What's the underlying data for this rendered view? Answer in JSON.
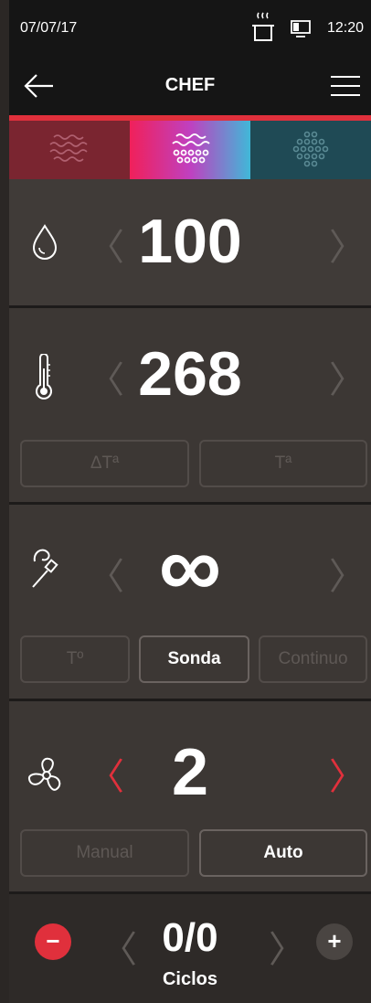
{
  "status_bar": {
    "date": "07/07/17",
    "time": "12:20",
    "icons": [
      "cooking-pot-icon",
      "monitor-icon"
    ]
  },
  "header": {
    "title": "CHEF",
    "back_icon": "arrow-left-icon",
    "menu_icon": "hamburger-menu-icon"
  },
  "mode_tabs": [
    {
      "icon": "waves-icon",
      "color": "#7a2530",
      "selected": false
    },
    {
      "icon": "waves-dotted-icon",
      "color": "#f0205a",
      "selected": true
    },
    {
      "icon": "dots-icon",
      "color": "#1f4a55",
      "selected": false
    }
  ],
  "humidity": {
    "icon": "droplet-icon",
    "value": "100",
    "prev": "〈",
    "next": "〉"
  },
  "temperature": {
    "icon": "thermometer-icon",
    "value": "268",
    "prev": "〈",
    "next": "〉",
    "buttons": [
      {
        "label": "ΔTª",
        "active": false
      },
      {
        "label": "Tª",
        "active": false
      }
    ]
  },
  "probe": {
    "icon": "probe-icon",
    "value": "∞",
    "prev": "〈",
    "next": "〉",
    "buttons": [
      {
        "label": "Tº",
        "active": false
      },
      {
        "label": "Sonda",
        "active": true
      },
      {
        "label": "Continuo",
        "active": false
      }
    ]
  },
  "fan": {
    "icon": "fan-icon",
    "value": "2",
    "prev": "〈",
    "next": "〉",
    "arrow_color": "#e0303c",
    "buttons": [
      {
        "label": "Manual",
        "active": false
      },
      {
        "label": "Auto",
        "active": true
      }
    ]
  },
  "cycles": {
    "value": "0/0",
    "label": "Ciclos",
    "minus": "−",
    "plus": "+",
    "prev": "〈",
    "next": "〉"
  },
  "colors": {
    "accent": "#e0303c",
    "background": "#3a3532",
    "bar": "#151515"
  }
}
